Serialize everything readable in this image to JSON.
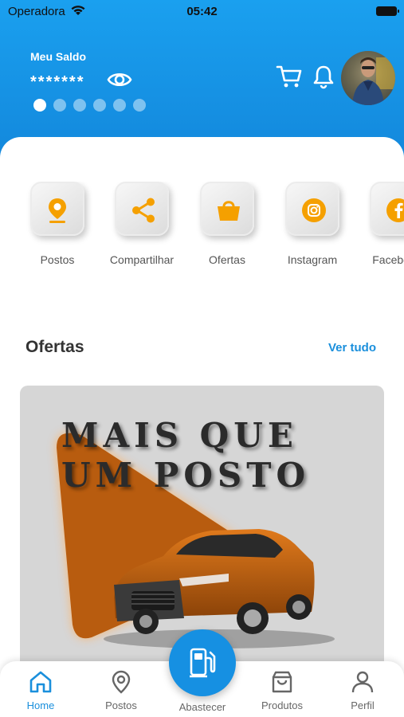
{
  "status": {
    "carrier": "Operadora",
    "time": "05:42"
  },
  "header": {
    "saldo_label": "Meu Saldo",
    "saldo_value": "*******",
    "carousel_pages": 6,
    "carousel_active": 1
  },
  "shortcuts": [
    {
      "label": "Postos",
      "icon": "location-pin-icon"
    },
    {
      "label": "Compartilhar",
      "icon": "share-icon"
    },
    {
      "label": "Ofertas",
      "icon": "shopping-bag-icon"
    },
    {
      "label": "Instagram",
      "icon": "instagram-icon"
    },
    {
      "label": "Facebook",
      "icon": "facebook-icon"
    }
  ],
  "ofertas": {
    "title": "Ofertas",
    "see_all": "Ver tudo",
    "banner": {
      "line1": "MAIS QUE",
      "line2": "UM POSTO"
    }
  },
  "nav": {
    "home": "Home",
    "postos": "Postos",
    "abastecer": "Abastecer",
    "produtos": "Produtos",
    "perfil": "Perfil"
  },
  "colors": {
    "primary": "#1a8fdc",
    "accent": "#f5a000",
    "banner_orange": "#b85c0f"
  }
}
